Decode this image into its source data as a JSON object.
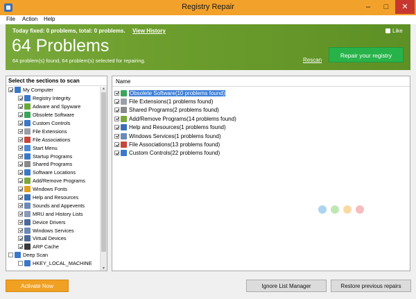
{
  "window": {
    "title": "Registry Repair",
    "minimize": "–",
    "maximize": "□",
    "close": "✕"
  },
  "menu": [
    "File",
    "Action",
    "Help"
  ],
  "banner": {
    "stats_line": "Today fixed: 0 problems, total: 0 problems.",
    "view_history": "View History",
    "like": "Like",
    "problems_title": "64 Problems",
    "subtitle": "64 problem(s) found, 64 problem(s) selected for repairing.",
    "rescan": "Rescan",
    "repair_button": "Repair your registry"
  },
  "left_panel": {
    "header": "Select the sections to scan",
    "root": {
      "label": "My Computer",
      "checked": true,
      "icon": "computer-icon",
      "color": "#3a78c9"
    },
    "items": [
      {
        "label": "Registry Integrity",
        "checked": true,
        "icon": "registry-integrity-icon",
        "color": "#3a78c9"
      },
      {
        "label": "Adware and Spyware",
        "checked": true,
        "icon": "adware-icon",
        "color": "#6aa83a"
      },
      {
        "label": "Obsolete Software",
        "checked": true,
        "icon": "obsolete-software-icon",
        "color": "#3aa55a"
      },
      {
        "label": "Custom Controls",
        "checked": true,
        "icon": "custom-controls-icon",
        "color": "#3a78c9"
      },
      {
        "label": "File Extensions",
        "checked": true,
        "icon": "file-extensions-icon",
        "color": "#9aa0a8"
      },
      {
        "label": "File Associations",
        "checked": true,
        "icon": "file-associations-icon",
        "color": "#c8463a"
      },
      {
        "label": "Start Menu",
        "checked": true,
        "icon": "start-menu-icon",
        "color": "#4a8ad8"
      },
      {
        "label": "Startup Programs",
        "checked": true,
        "icon": "startup-programs-icon",
        "color": "#3a78c9"
      },
      {
        "label": "Shared Programs",
        "checked": true,
        "icon": "shared-programs-icon",
        "color": "#8a8a8a"
      },
      {
        "label": "Software Locations",
        "checked": true,
        "icon": "software-locations-icon",
        "color": "#3a78c9"
      },
      {
        "label": "Add/Remove Programs",
        "checked": true,
        "icon": "add-remove-programs-icon",
        "color": "#7aa83a"
      },
      {
        "label": "Windows Fonts",
        "checked": true,
        "icon": "windows-fonts-icon",
        "color": "#e0a020"
      },
      {
        "label": "Help and Resources",
        "checked": true,
        "icon": "help-icon",
        "color": "#3a6fb6"
      },
      {
        "label": "Sounds and Appevents",
        "checked": true,
        "icon": "sounds-icon",
        "color": "#6a8ab8"
      },
      {
        "label": "MRU and History Lists",
        "checked": true,
        "icon": "history-icon",
        "color": "#8a9ab8"
      },
      {
        "label": "Device Drivers",
        "checked": true,
        "icon": "device-drivers-icon",
        "color": "#4a6a9a"
      },
      {
        "label": "Windows Services",
        "checked": true,
        "icon": "windows-services-icon",
        "color": "#6a8ab8"
      },
      {
        "label": "Virtual Devices",
        "checked": true,
        "icon": "virtual-devices-icon",
        "color": "#4a6a9a"
      },
      {
        "label": "ARP Cache",
        "checked": true,
        "icon": "arp-cache-icon",
        "color": "#3a3a3a"
      }
    ],
    "deep_scan": {
      "label": "Deep Scan",
      "checked": false,
      "icon": "deep-scan-icon",
      "color": "#3a78c9"
    },
    "hklm": {
      "label": "HKEY_LOCAL_MACHINE",
      "checked": false,
      "icon": "registry-key-icon",
      "color": "#3a78c9"
    }
  },
  "right_panel": {
    "column_header": "Name",
    "results": [
      {
        "label": "Obsolete Software(10 problems found)",
        "checked": true,
        "icon": "obsolete-software-icon",
        "color": "#3aa55a",
        "selected": true
      },
      {
        "label": "File Extensions(1 problems found)",
        "checked": true,
        "icon": "file-extensions-icon",
        "color": "#9aa0a8"
      },
      {
        "label": "Shared Programs(2 problems found)",
        "checked": true,
        "icon": "shared-programs-icon",
        "color": "#8a8a8a"
      },
      {
        "label": "Add/Remove Programs(14 problems found)",
        "checked": true,
        "icon": "add-remove-programs-icon",
        "color": "#7aa83a"
      },
      {
        "label": "Help and Resources(1 problems found)",
        "checked": true,
        "icon": "help-icon",
        "color": "#3a6fb6"
      },
      {
        "label": "Windows Services(1 problems found)",
        "checked": true,
        "icon": "windows-services-icon",
        "color": "#6a8ab8"
      },
      {
        "label": "File Associations(13 problems found)",
        "checked": true,
        "icon": "file-associations-icon",
        "color": "#c8463a"
      },
      {
        "label": "Custom Controls(22 problems found)",
        "checked": true,
        "icon": "custom-controls-icon",
        "color": "#3a78c9"
      }
    ],
    "watermark_colors": [
      "#5aa9e0",
      "#7fcf6a",
      "#f5b54a",
      "#f07a7a"
    ]
  },
  "buttons": {
    "activate": "Activate Now",
    "ignore": "Ignore List Manager",
    "restore": "Restore previous repairs"
  }
}
